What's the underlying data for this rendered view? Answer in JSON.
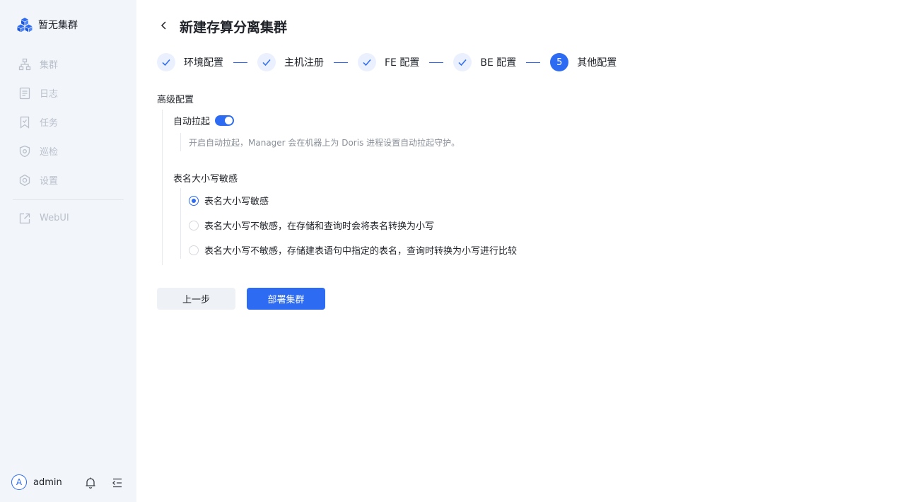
{
  "sidebar": {
    "brand": "暂无集群",
    "nav": [
      {
        "label": "集群",
        "icon": "cluster-icon"
      },
      {
        "label": "日志",
        "icon": "log-icon"
      },
      {
        "label": "任务",
        "icon": "task-icon"
      },
      {
        "label": "巡检",
        "icon": "inspect-icon"
      },
      {
        "label": "设置",
        "icon": "settings-icon"
      }
    ],
    "webui": {
      "label": "WebUI",
      "icon": "external-link-icon"
    },
    "user": {
      "avatar_letter": "A",
      "name": "admin"
    }
  },
  "header": {
    "title": "新建存算分离集群"
  },
  "steps": [
    {
      "label": "环境配置",
      "status": "done"
    },
    {
      "label": "主机注册",
      "status": "done"
    },
    {
      "label": "FE 配置",
      "status": "done"
    },
    {
      "label": "BE 配置",
      "status": "done"
    },
    {
      "label": "其他配置",
      "status": "active",
      "number": "5"
    }
  ],
  "form": {
    "section_title": "高级配置",
    "autostart": {
      "label": "自动拉起",
      "enabled": true,
      "description": "开启自动拉起，Manager 会在机器上为 Doris 进程设置自动拉起守护。"
    },
    "case_sensitivity": {
      "label": "表名大小写敏感",
      "options": [
        {
          "label": "表名大小写敏感",
          "checked": true
        },
        {
          "label": "表名大小写不敏感，在存储和查询时会将表名转换为小写",
          "checked": false
        },
        {
          "label": "表名大小写不敏感，存储建表语句中指定的表名，查询时转换为小写进行比较",
          "checked": false
        }
      ]
    }
  },
  "actions": {
    "prev_label": "上一步",
    "deploy_label": "部署集群"
  },
  "colors": {
    "accent": "#2c6bf2",
    "sidebar_bg": "#f2f5fa",
    "step_done_bg": "#eaf0fe"
  }
}
